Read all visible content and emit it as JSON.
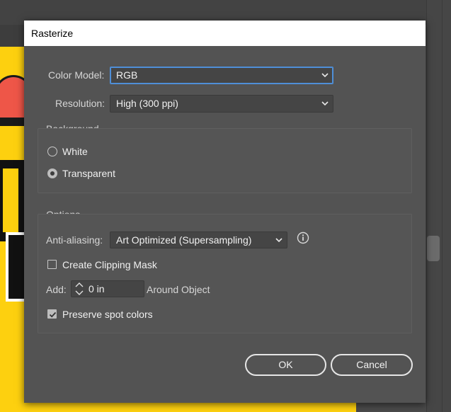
{
  "dialog": {
    "title": "Rasterize",
    "color_model": {
      "label": "Color Model:",
      "value": "RGB"
    },
    "resolution": {
      "label": "Resolution:",
      "value": "High (300 ppi)"
    },
    "background": {
      "title": "Background",
      "options": [
        {
          "label": "White",
          "selected": false
        },
        {
          "label": "Transparent",
          "selected": true
        }
      ]
    },
    "options": {
      "title": "Options",
      "anti_aliasing": {
        "label": "Anti-aliasing:",
        "value": "Art Optimized (Supersampling)"
      },
      "clipping_mask": {
        "label": "Create Clipping Mask",
        "checked": false
      },
      "add": {
        "label": "Add:",
        "value": "0 in",
        "suffix": "Around Object"
      },
      "preserve_spot": {
        "label": "Preserve spot colors",
        "checked": true
      }
    },
    "buttons": {
      "ok": "OK",
      "cancel": "Cancel"
    }
  },
  "colors": {
    "dialog_bg": "#535353",
    "artboard": "#fdd00f",
    "focus_ring": "#4f8fd8"
  },
  "icons": [
    "chevron-down-icon",
    "info-icon",
    "stepper-arrows-icon",
    "checkmark-icon"
  ]
}
